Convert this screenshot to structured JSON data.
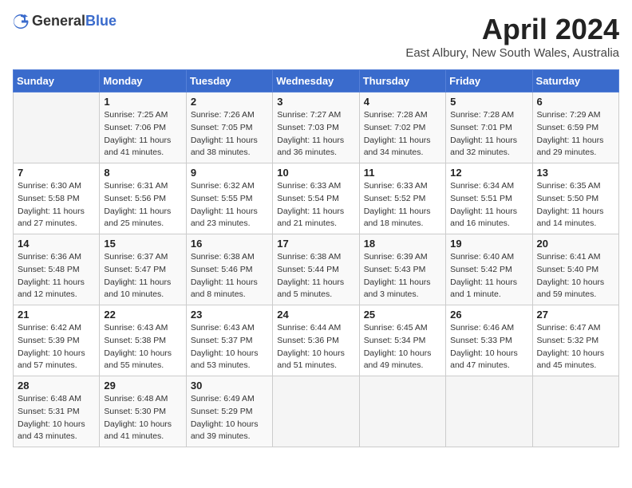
{
  "header": {
    "logo_general": "General",
    "logo_blue": "Blue",
    "month": "April 2024",
    "location": "East Albury, New South Wales, Australia"
  },
  "weekdays": [
    "Sunday",
    "Monday",
    "Tuesday",
    "Wednesday",
    "Thursday",
    "Friday",
    "Saturday"
  ],
  "weeks": [
    [
      {
        "day": "",
        "info": ""
      },
      {
        "day": "1",
        "info": "Sunrise: 7:25 AM\nSunset: 7:06 PM\nDaylight: 11 hours\nand 41 minutes."
      },
      {
        "day": "2",
        "info": "Sunrise: 7:26 AM\nSunset: 7:05 PM\nDaylight: 11 hours\nand 38 minutes."
      },
      {
        "day": "3",
        "info": "Sunrise: 7:27 AM\nSunset: 7:03 PM\nDaylight: 11 hours\nand 36 minutes."
      },
      {
        "day": "4",
        "info": "Sunrise: 7:28 AM\nSunset: 7:02 PM\nDaylight: 11 hours\nand 34 minutes."
      },
      {
        "day": "5",
        "info": "Sunrise: 7:28 AM\nSunset: 7:01 PM\nDaylight: 11 hours\nand 32 minutes."
      },
      {
        "day": "6",
        "info": "Sunrise: 7:29 AM\nSunset: 6:59 PM\nDaylight: 11 hours\nand 29 minutes."
      }
    ],
    [
      {
        "day": "7",
        "info": "Sunrise: 6:30 AM\nSunset: 5:58 PM\nDaylight: 11 hours\nand 27 minutes."
      },
      {
        "day": "8",
        "info": "Sunrise: 6:31 AM\nSunset: 5:56 PM\nDaylight: 11 hours\nand 25 minutes."
      },
      {
        "day": "9",
        "info": "Sunrise: 6:32 AM\nSunset: 5:55 PM\nDaylight: 11 hours\nand 23 minutes."
      },
      {
        "day": "10",
        "info": "Sunrise: 6:33 AM\nSunset: 5:54 PM\nDaylight: 11 hours\nand 21 minutes."
      },
      {
        "day": "11",
        "info": "Sunrise: 6:33 AM\nSunset: 5:52 PM\nDaylight: 11 hours\nand 18 minutes."
      },
      {
        "day": "12",
        "info": "Sunrise: 6:34 AM\nSunset: 5:51 PM\nDaylight: 11 hours\nand 16 minutes."
      },
      {
        "day": "13",
        "info": "Sunrise: 6:35 AM\nSunset: 5:50 PM\nDaylight: 11 hours\nand 14 minutes."
      }
    ],
    [
      {
        "day": "14",
        "info": "Sunrise: 6:36 AM\nSunset: 5:48 PM\nDaylight: 11 hours\nand 12 minutes."
      },
      {
        "day": "15",
        "info": "Sunrise: 6:37 AM\nSunset: 5:47 PM\nDaylight: 11 hours\nand 10 minutes."
      },
      {
        "day": "16",
        "info": "Sunrise: 6:38 AM\nSunset: 5:46 PM\nDaylight: 11 hours\nand 8 minutes."
      },
      {
        "day": "17",
        "info": "Sunrise: 6:38 AM\nSunset: 5:44 PM\nDaylight: 11 hours\nand 5 minutes."
      },
      {
        "day": "18",
        "info": "Sunrise: 6:39 AM\nSunset: 5:43 PM\nDaylight: 11 hours\nand 3 minutes."
      },
      {
        "day": "19",
        "info": "Sunrise: 6:40 AM\nSunset: 5:42 PM\nDaylight: 11 hours\nand 1 minute."
      },
      {
        "day": "20",
        "info": "Sunrise: 6:41 AM\nSunset: 5:40 PM\nDaylight: 10 hours\nand 59 minutes."
      }
    ],
    [
      {
        "day": "21",
        "info": "Sunrise: 6:42 AM\nSunset: 5:39 PM\nDaylight: 10 hours\nand 57 minutes."
      },
      {
        "day": "22",
        "info": "Sunrise: 6:43 AM\nSunset: 5:38 PM\nDaylight: 10 hours\nand 55 minutes."
      },
      {
        "day": "23",
        "info": "Sunrise: 6:43 AM\nSunset: 5:37 PM\nDaylight: 10 hours\nand 53 minutes."
      },
      {
        "day": "24",
        "info": "Sunrise: 6:44 AM\nSunset: 5:36 PM\nDaylight: 10 hours\nand 51 minutes."
      },
      {
        "day": "25",
        "info": "Sunrise: 6:45 AM\nSunset: 5:34 PM\nDaylight: 10 hours\nand 49 minutes."
      },
      {
        "day": "26",
        "info": "Sunrise: 6:46 AM\nSunset: 5:33 PM\nDaylight: 10 hours\nand 47 minutes."
      },
      {
        "day": "27",
        "info": "Sunrise: 6:47 AM\nSunset: 5:32 PM\nDaylight: 10 hours\nand 45 minutes."
      }
    ],
    [
      {
        "day": "28",
        "info": "Sunrise: 6:48 AM\nSunset: 5:31 PM\nDaylight: 10 hours\nand 43 minutes."
      },
      {
        "day": "29",
        "info": "Sunrise: 6:48 AM\nSunset: 5:30 PM\nDaylight: 10 hours\nand 41 minutes."
      },
      {
        "day": "30",
        "info": "Sunrise: 6:49 AM\nSunset: 5:29 PM\nDaylight: 10 hours\nand 39 minutes."
      },
      {
        "day": "",
        "info": ""
      },
      {
        "day": "",
        "info": ""
      },
      {
        "day": "",
        "info": ""
      },
      {
        "day": "",
        "info": ""
      }
    ]
  ]
}
